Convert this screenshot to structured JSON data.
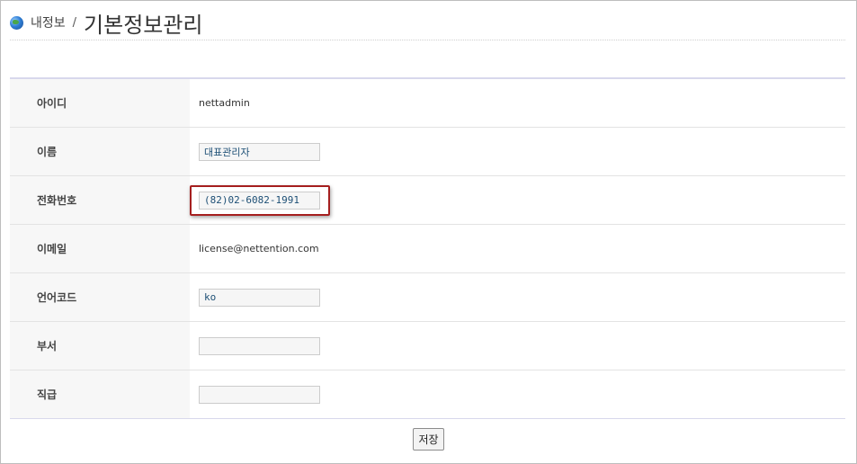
{
  "header": {
    "breadcrumb": "내정보",
    "separator": "/",
    "title": "기본정보관리"
  },
  "form": {
    "fields": [
      {
        "label": "아이디",
        "value": "nettadmin",
        "type": "text"
      },
      {
        "label": "이름",
        "value": "대표관리자",
        "type": "input"
      },
      {
        "label": "전화번호",
        "value": "(82)02-6082-1991",
        "type": "input",
        "highlighted": true
      },
      {
        "label": "이메일",
        "value": "license@nettention.com",
        "type": "text"
      },
      {
        "label": "언어코드",
        "value": "ko",
        "type": "input"
      },
      {
        "label": "부서",
        "value": "",
        "type": "input"
      },
      {
        "label": "직급",
        "value": "",
        "type": "input"
      }
    ]
  },
  "actions": {
    "save_label": "저장"
  },
  "colors": {
    "highlight_border": "#a51f1f",
    "input_text": "#1d4f75"
  }
}
